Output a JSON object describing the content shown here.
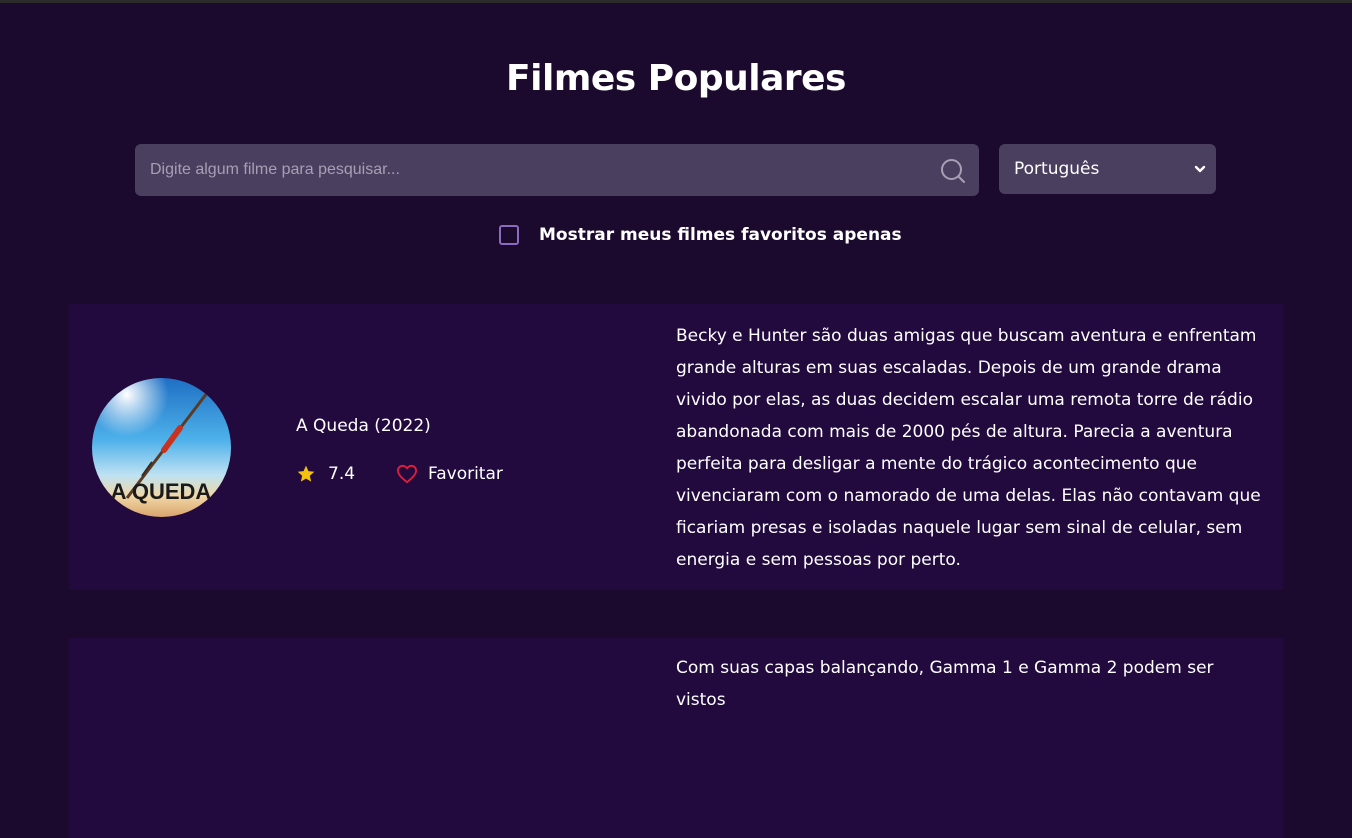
{
  "header": {
    "title": "Filmes Populares"
  },
  "search": {
    "placeholder": "Digite algum filme para pesquisar...",
    "value": ""
  },
  "language_select": {
    "selected": "Português"
  },
  "favorites_filter": {
    "label": "Mostrar meus filmes favoritos apenas",
    "checked": false
  },
  "movies": [
    {
      "title": "A Queda (2022)",
      "rating": "7.4",
      "favorite_label": "Favoritar",
      "poster_text": "A QUEDA",
      "overview": "Becky e Hunter são duas amigas que buscam aventura e enfrentam grande alturas em suas escaladas. Depois de um grande drama vivido por elas, as duas decidem escalar uma remota torre de rádio abandonada com mais de 2000 pés de altura. Parecia a aventura perfeita para desligar a mente do trágico acontecimento que vivenciaram com o namorado de uma delas. Elas não contavam que ficariam presas e isoladas naquele lugar sem sinal de celular, sem energia e sem pessoas por perto."
    },
    {
      "overview": "Com suas capas balançando, Gamma 1 e Gamma 2 podem ser vistos"
    }
  ],
  "colors": {
    "background": "#1c0a2e",
    "card": "#220a3f",
    "input": "#4b3f5f",
    "star": "#f4c10f",
    "heart": "#e01e3c",
    "checkbox_border": "#8a6bbd"
  },
  "icons": [
    "search-icon",
    "chevron-down-icon",
    "star-icon",
    "heart-icon"
  ]
}
